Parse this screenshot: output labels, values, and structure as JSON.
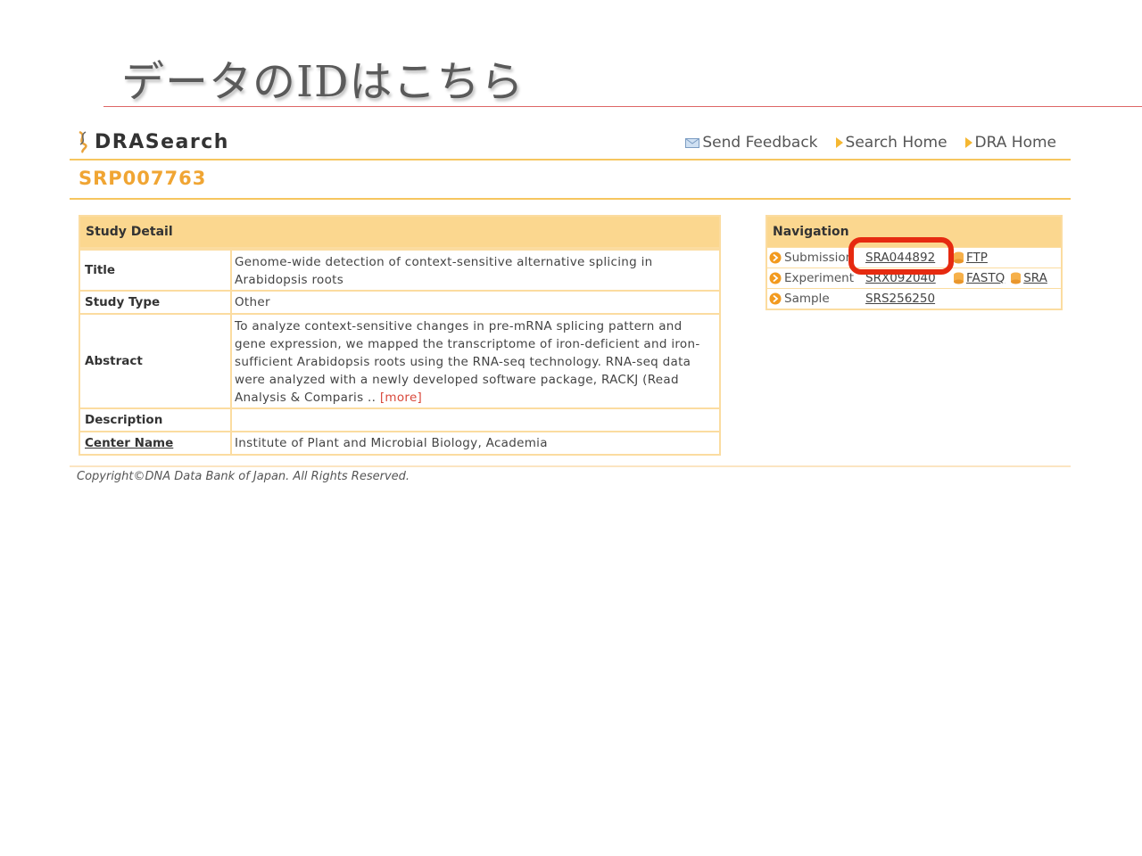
{
  "slide": {
    "title": "データのIDはこちら"
  },
  "header": {
    "logo_text": "DRASearch",
    "links": [
      {
        "label": "Send Feedback",
        "icon": "mail-icon"
      },
      {
        "label": "Search Home",
        "icon": "arrow-right-icon"
      },
      {
        "label": "DRA Home",
        "icon": "arrow-right-icon"
      }
    ]
  },
  "accession": "SRP007763",
  "study": {
    "heading": "Study Detail",
    "rows": [
      {
        "label": "Title",
        "value": "Genome-wide detection of context-sensitive alternative splicing in Arabidopsis roots"
      },
      {
        "label": "Study Type",
        "value": "Other"
      },
      {
        "label": "Abstract",
        "value": "To analyze context-sensitive changes in pre-mRNA splicing pattern and gene expression, we mapped the transcriptome of iron-deficient and iron-sufficient Arabidopsis roots using the RNA-seq technology. RNA-seq data were analyzed with a newly developed software package, RACKJ (Read Analysis & Comparis ..",
        "more": "[more]"
      },
      {
        "label": "Description",
        "value": ""
      },
      {
        "label": "Center Name",
        "value": "Institute of Plant and Microbial Biology, Academia"
      }
    ]
  },
  "navigation": {
    "heading": "Navigation",
    "rows": [
      {
        "label": "Submission",
        "id": "SRA044892",
        "extras": [
          "FTP"
        ]
      },
      {
        "label": "Experiment",
        "id": "SRX092040",
        "extras": [
          "FASTQ",
          "SRA"
        ]
      },
      {
        "label": "Sample",
        "id": "SRS256250",
        "extras": []
      }
    ]
  },
  "footer": {
    "copyright": "Copyright©DNA Data Bank of Japan. All Rights Reserved."
  },
  "colors": {
    "accent": "#f0a533",
    "header_bg": "#fbd78f",
    "border": "#fbdca0",
    "highlight": "#e62a10",
    "rule": "#dd6666"
  }
}
